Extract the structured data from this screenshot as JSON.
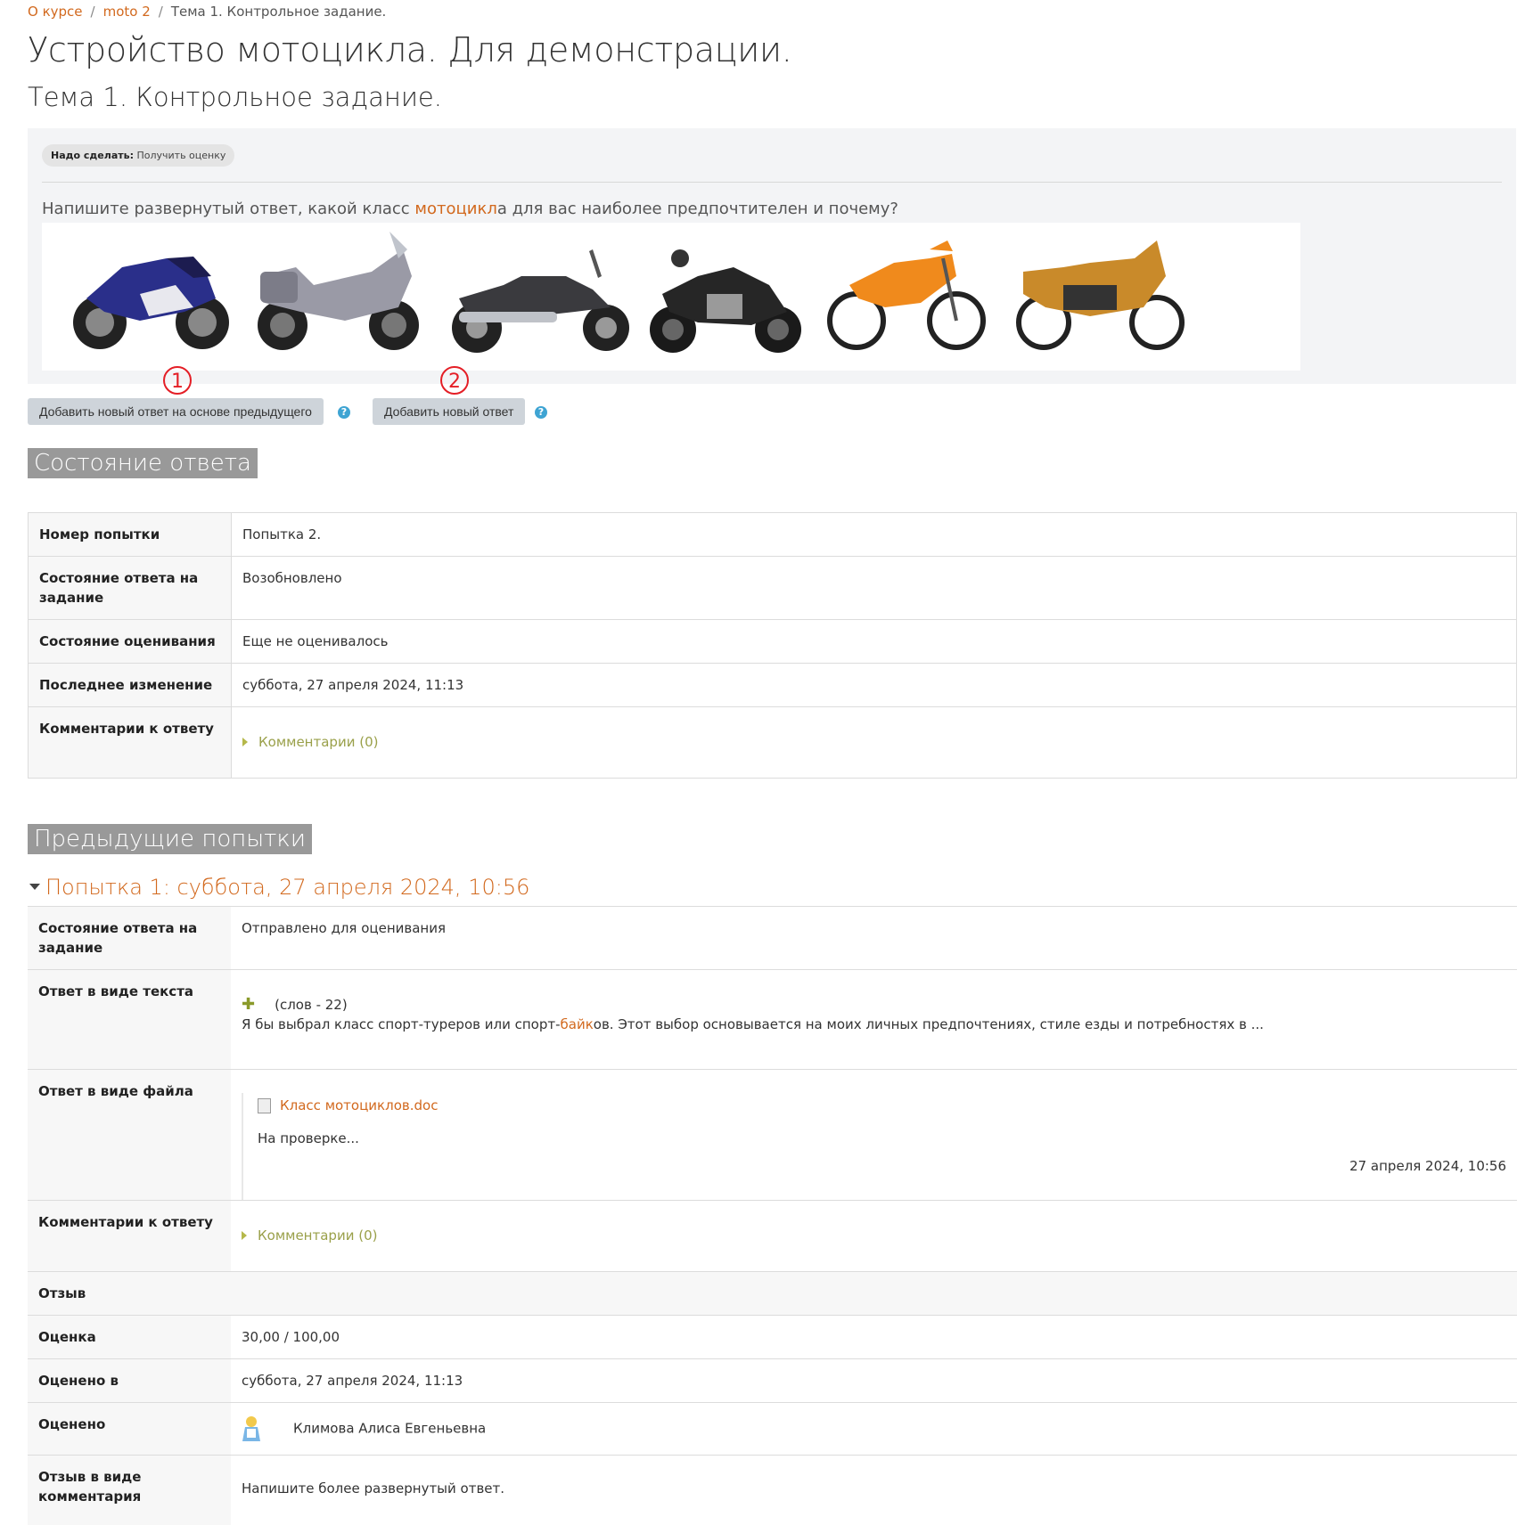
{
  "breadcrumb": {
    "items": [
      "О курсе",
      "moto 2",
      "Тема 1. Контрольное задание."
    ]
  },
  "page": {
    "course_title": "Устройство мотоцикла. Для демонстрации.",
    "assignment_title": "Тема 1. Контрольное задание."
  },
  "task": {
    "todo_label": "Надо сделать:",
    "todo_value": "Получить оценку",
    "question_before": "Напишите развернутый ответ, какой класс ",
    "question_link": "мотоцикл",
    "question_after": "а для вас наиболее предпочтителен и почему?"
  },
  "markers": {
    "m1": "1",
    "m2": "2"
  },
  "buttons": {
    "add_based_on_previous": "Добавить новый ответ на основе предыдущего",
    "add_new": "Добавить новый ответ",
    "help_glyph": "?"
  },
  "submission_status": {
    "heading": "Состояние ответа",
    "rows": [
      {
        "label": "Номер попытки",
        "value": "Попытка 2."
      },
      {
        "label": "Состояние ответа на задание",
        "value": "Возобновлено"
      },
      {
        "label": "Состояние оценивания",
        "value": "Еще не оценивалось"
      },
      {
        "label": "Последнее изменение",
        "value": "суббота, 27 апреля 2024, 11:13"
      },
      {
        "label": "Комментарии к ответу",
        "value": "Комментарии (0)"
      }
    ]
  },
  "previous_attempts": {
    "heading": "Предыдущие попытки",
    "attempt_title": "Попытка 1: суббота, 27 апреля 2024, 10:56",
    "status_label": "Состояние ответа на задание",
    "status_value": "Отправлено для оценивания",
    "text_label": "Ответ в виде текста",
    "word_count": "(слов - 22)",
    "text_before": "Я бы выбрал класс спорт-туреров или спорт-",
    "text_link": "байк",
    "text_after": "ов. Этот выбор основывается на моих личных предпочтениях, стиле езды и потребностях в ...",
    "file_label": "Ответ в виде файла",
    "file_name": "Класс мотоциклов.doc",
    "file_status": "На проверке...",
    "file_date": "27 апреля 2024, 10:56",
    "comments_label": "Комментарии к ответу",
    "comments_value": "Комментарии (0)",
    "feedback_label": "Отзыв",
    "grade_label": "Оценка",
    "grade_value": "30,00 / 100,00",
    "graded_on_label": "Оценено в",
    "graded_on_value": "суббота, 27 апреля 2024, 11:13",
    "graded_by_label": "Оценено",
    "graded_by_value": "Климова Алиса Евгеньевна",
    "comment_feedback_label": "Отзыв в виде комментария",
    "comment_feedback_value": "Напишите более развернутый ответ."
  },
  "colors": {
    "link": "#d2691e",
    "marker": "#e41e26",
    "section_heading_bg": "#999999",
    "help": "#3ea4d3"
  },
  "icons": [
    "help-icon",
    "expand-triangle-icon",
    "collapse-triangle-icon",
    "plus-icon",
    "document-icon",
    "user-avatar-icon"
  ]
}
